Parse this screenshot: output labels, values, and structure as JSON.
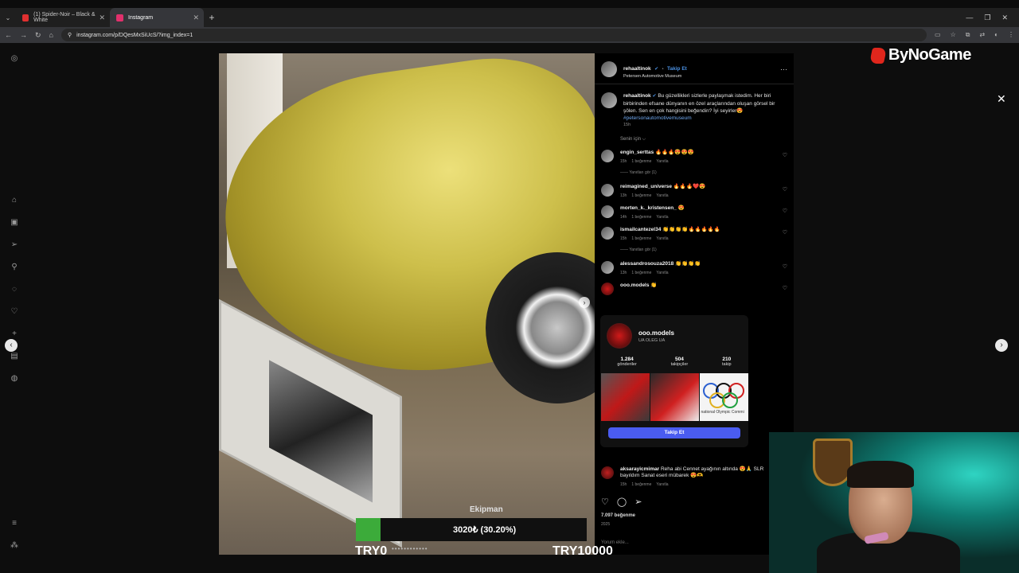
{
  "tabs": [
    {
      "title": "(1) Spider-Noir – Black & White",
      "color": "#e03030"
    },
    {
      "title": "Instagram",
      "color": "#e1306c"
    }
  ],
  "address": {
    "url": "instagram.com/p/DQesMxSiUcS/?img_index=1"
  },
  "post": {
    "username": "rehaaltinok",
    "follow_label": "Takip Et",
    "location": "Petersen Automotive Museum",
    "caption_user": "rehaaltinok",
    "caption_text": "Bu güzellikleri sizlerle paylaşmak istedim. Her biri birbirinden efsane dünyanın en özel araçlarından oluşan görsel bir şölen. Sen en çok hangisini beğendin? İyi seyirler😍",
    "hashtag": "#petersonautomotivemuseum",
    "caption_time": "15h",
    "for_you": "Senin için ⌵"
  },
  "comments": [
    {
      "user": "engin_serttas",
      "text": "🔥🔥🔥😍😍😍",
      "time": "15h",
      "likes": "1 beğenme",
      "reply": "Yanıtla",
      "replies": "Yanıtları gör (1)"
    },
    {
      "user": "reimagined_universe",
      "text": "🔥🔥🔥❤️😍",
      "time": "13h",
      "likes": "1 beğenme",
      "reply": "Yanıtla"
    },
    {
      "user": "morten_k._kristensen_",
      "text": "😍",
      "time": "14h",
      "likes": "1 beğenme",
      "reply": "Yanıtla"
    },
    {
      "user": "ismailcantezel34",
      "text": "👏👏👏👏🔥🔥🔥🔥🔥",
      "time": "15h",
      "likes": "1 beğenme",
      "reply": "Yanıtla",
      "replies": "Yanıtları gör (1)"
    },
    {
      "user": "alessandrosouza2018",
      "text": "👏👏👏👏",
      "time": "13h",
      "likes": "1 beğenme",
      "reply": "Yanıtla"
    },
    {
      "user": "ooo.models",
      "text": "👏"
    }
  ],
  "last_comment": {
    "user": "aksarayicmimar",
    "text": "Reha abi Cennet ayağının altında 😍🙏 SLR bayıldım Sanat eseri mübarek 😍🫶",
    "time": "15h",
    "likes": "1 beğenme",
    "reply": "Yanıtla"
  },
  "hovercard": {
    "name": "ooo.models",
    "sub": "UA OLEG UA",
    "stats": [
      {
        "n": "1.284",
        "l": "gönderiler"
      },
      {
        "n": "504",
        "l": "takipçiler"
      },
      {
        "n": "210",
        "l": "takip"
      }
    ],
    "grid_caption": "national Olympic Commi",
    "button": "Takip Et"
  },
  "footer": {
    "likes": "7.097 beğenme",
    "date": "2025",
    "add_comment": "Yorum ekle..."
  },
  "brand": {
    "name": "ByNoGame"
  },
  "overlay": {
    "label": "Ekipman",
    "value": "3020₺ (30.20%)",
    "progress": 0.302,
    "min": "TRY0",
    "max": "TRY10000"
  },
  "colors": {
    "accent": "#4a5cf0",
    "progress": "#3cab3a",
    "link": "#4a90e2"
  }
}
